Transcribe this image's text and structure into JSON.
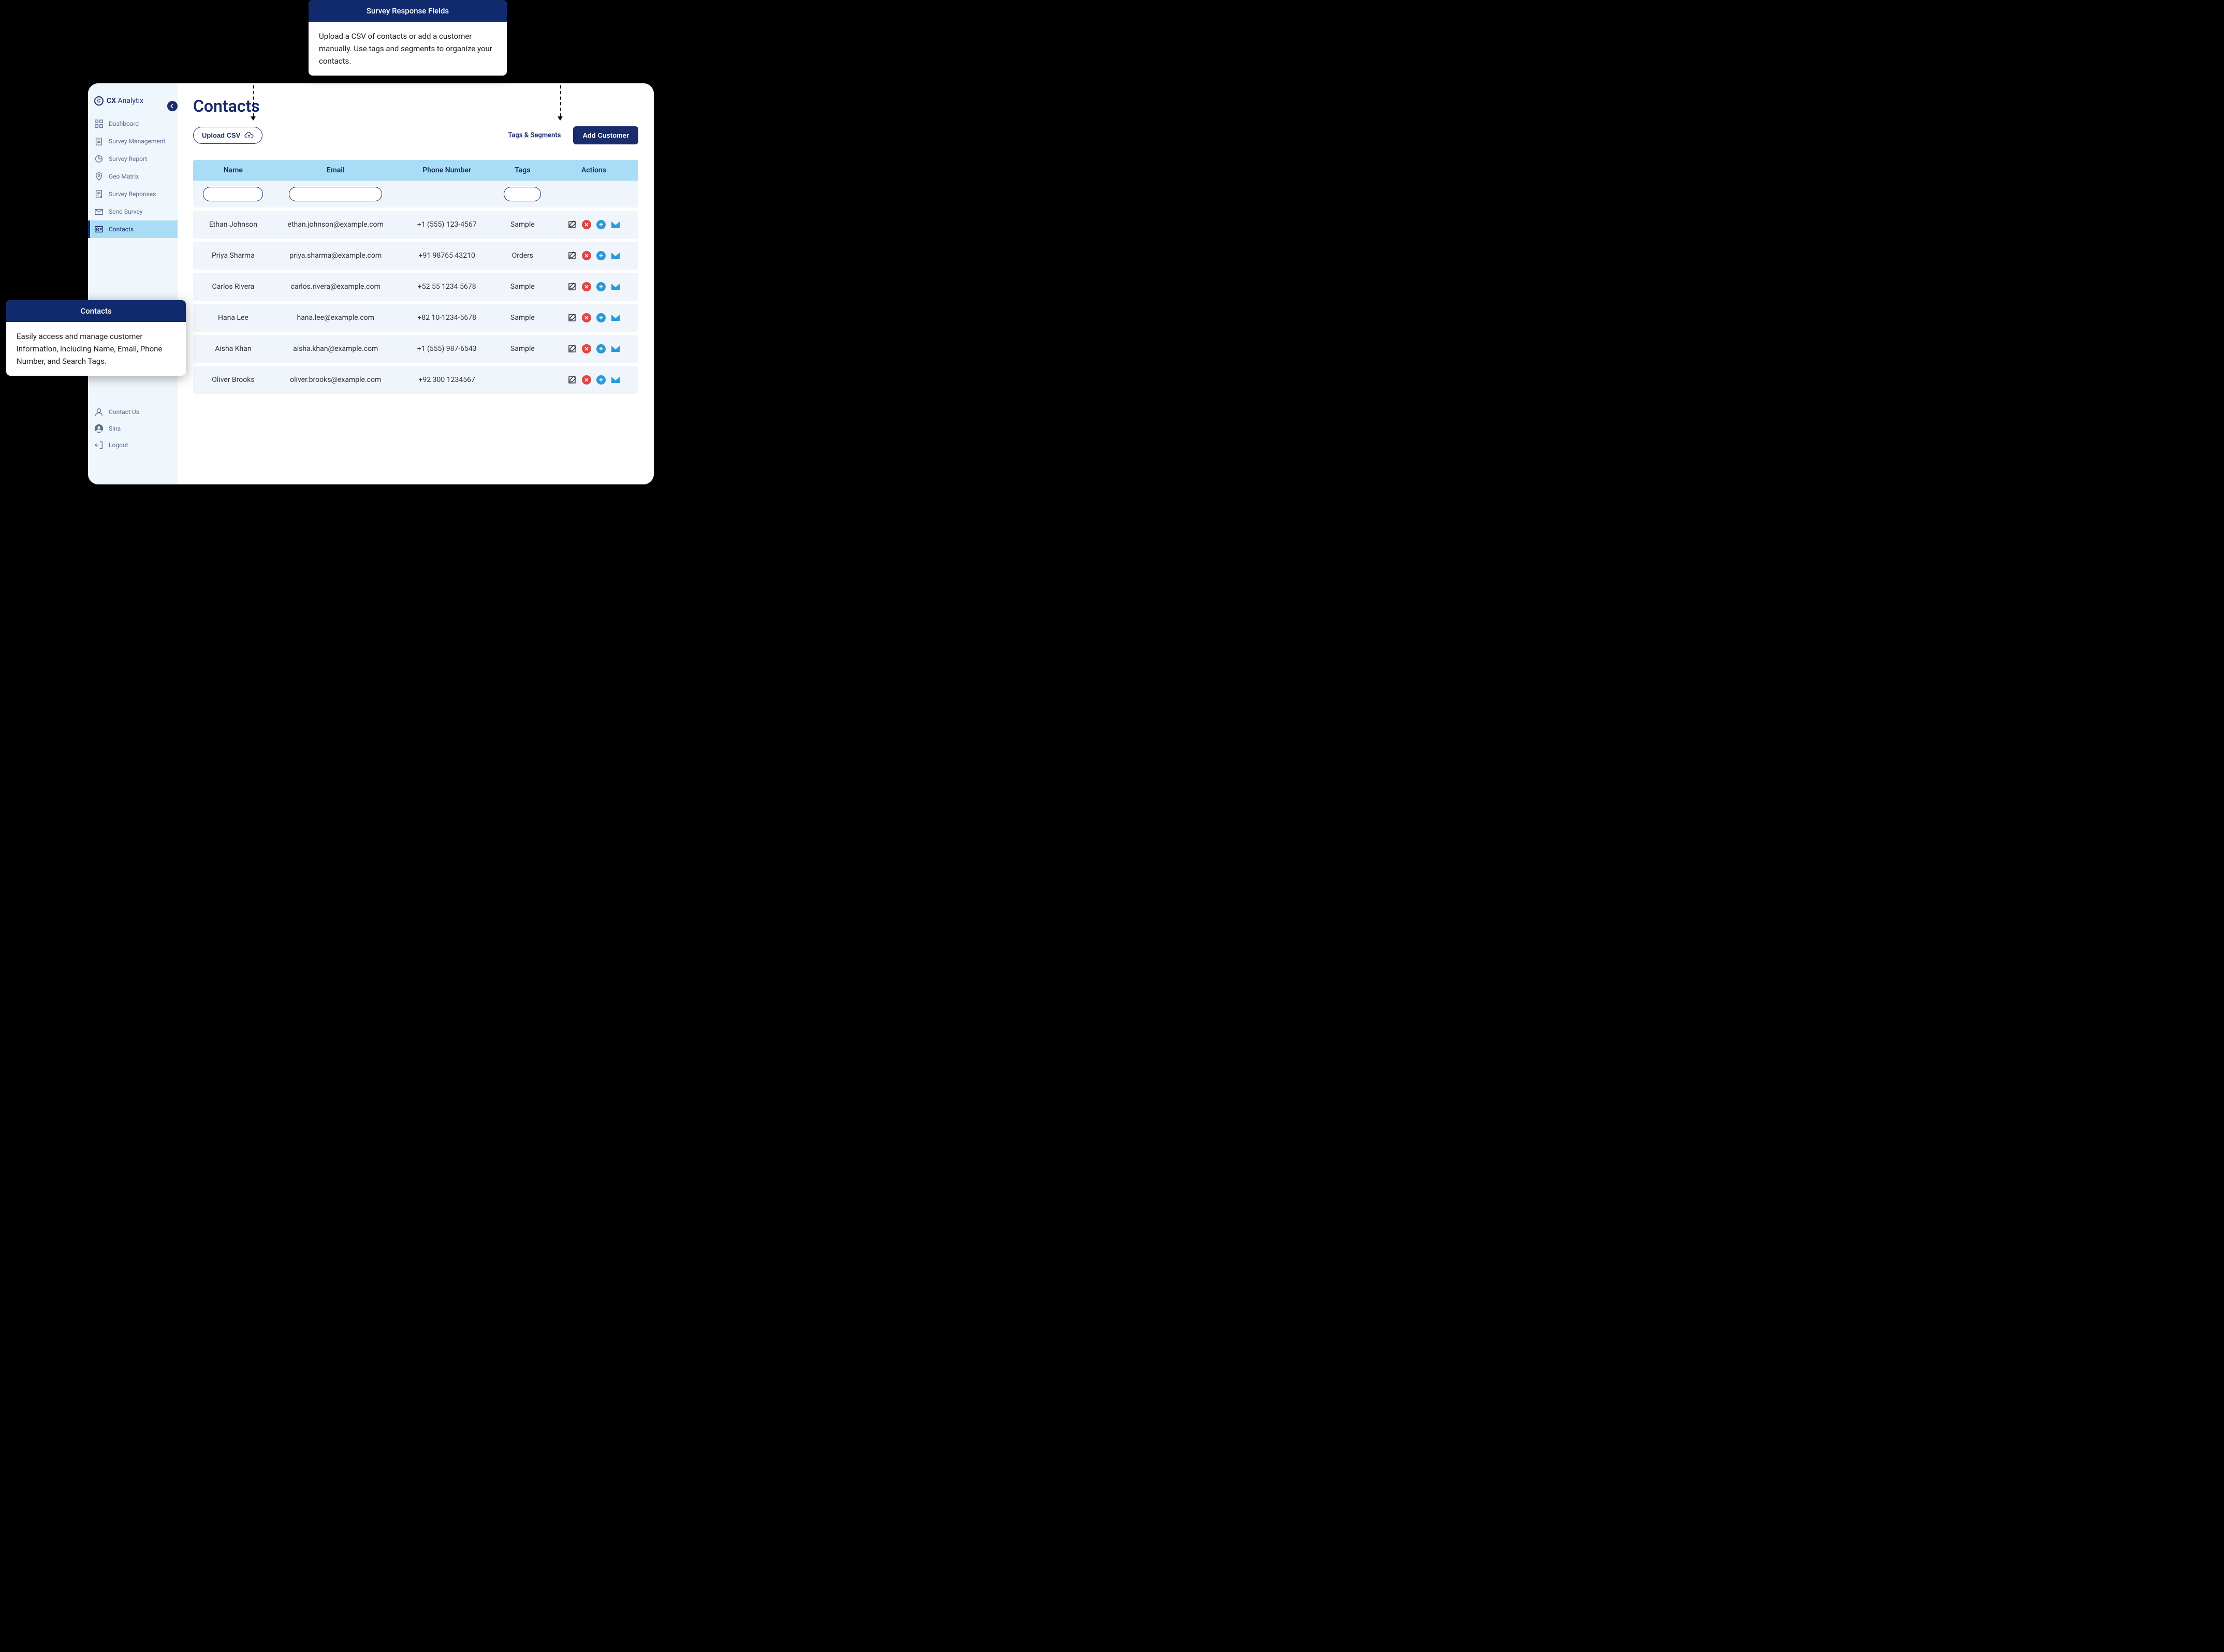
{
  "brand": {
    "bold": "CX",
    "light": "Analytix"
  },
  "sidebar": {
    "items": [
      {
        "label": "Dashboard"
      },
      {
        "label": "Survey Management"
      },
      {
        "label": "Survey Report"
      },
      {
        "label": "Geo Matrix"
      },
      {
        "label": "Survey Reponses"
      },
      {
        "label": "Send Survey"
      },
      {
        "label": "Contacts"
      }
    ],
    "footer": [
      {
        "label": "Contact Us"
      },
      {
        "label": "Sina"
      },
      {
        "label": "Logout"
      }
    ]
  },
  "page": {
    "title": "Contacts",
    "upload_label": "Upload CSV",
    "tags_link": "Tags & Segments",
    "add_label": "Add Customer"
  },
  "table": {
    "headers": {
      "name": "Name",
      "email": "Email",
      "phone": "Phone Number",
      "tags": "Tags",
      "actions": "Actions"
    },
    "rows": [
      {
        "name": "Ethan Johnson",
        "email": "ethan.johnson@example.com",
        "phone": "+1 (555) 123-4567",
        "tags": "Sample"
      },
      {
        "name": "Priya Sharma",
        "email": "priya.sharma@example.com",
        "phone": "+91 98765 43210",
        "tags": "Orders"
      },
      {
        "name": "Carlos Rivera",
        "email": "carlos.rivera@example.com",
        "phone": "+52 55 1234 5678",
        "tags": "Sample"
      },
      {
        "name": "Hana Lee",
        "email": "hana.lee@example.com",
        "phone": "+82 10-1234-5678",
        "tags": "Sample"
      },
      {
        "name": "Aisha Khan",
        "email": "aisha.khan@example.com",
        "phone": "+1 (555) 987-6543",
        "tags": "Sample"
      },
      {
        "name": "Oliver Brooks",
        "email": "oliver.brooks@example.com",
        "phone": "+92 300 1234567",
        "tags": ""
      }
    ]
  },
  "callouts": {
    "top": {
      "title": "Survey Response Fields",
      "body": "Upload a CSV of contacts or add a customer manually. Use tags and segments to organize your contacts."
    },
    "left": {
      "title": "Contacts",
      "body": "Easily access and manage customer information, including Name, Email, Phone Number, and Search Tags."
    }
  }
}
